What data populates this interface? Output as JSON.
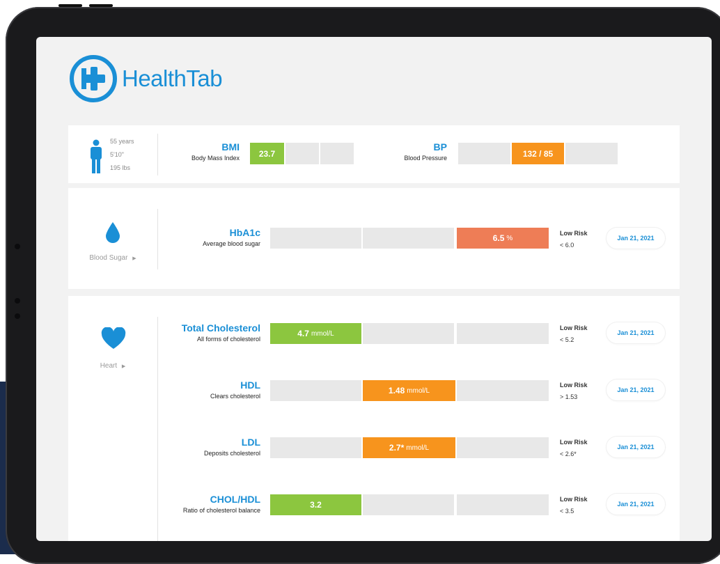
{
  "app": {
    "name": "HealthTab"
  },
  "profile": {
    "age": "55 years",
    "height": "5'10\"",
    "weight": "195 lbs"
  },
  "vitals": {
    "bmi": {
      "title": "BMI",
      "subtitle": "Body Mass Index",
      "value": "23.7",
      "level": 1
    },
    "bp": {
      "title": "BP",
      "subtitle": "Blood Pressure",
      "value": "132 / 85",
      "level": 2
    }
  },
  "sections": {
    "blood_sugar": {
      "label": "Blood Sugar",
      "metrics": {
        "hba1c": {
          "title": "HbA1c",
          "subtitle": "Average blood sugar",
          "value": "6.5",
          "unit": "%",
          "risk": "Low Risk",
          "threshold": "< 6.0",
          "date": "Jan 21, 2021",
          "level": 3
        }
      }
    },
    "heart": {
      "label": "Heart",
      "metrics": {
        "total": {
          "title": "Total Cholesterol",
          "subtitle": "All forms of cholesterol",
          "value": "4.7",
          "unit": "mmol/L",
          "risk": "Low Risk",
          "threshold": "< 5.2",
          "date": "Jan 21, 2021",
          "level": 1
        },
        "hdl": {
          "title": "HDL",
          "subtitle": "Clears cholesterol",
          "value": "1.48",
          "unit": "mmol/L",
          "risk": "Low Risk",
          "threshold": "> 1.53",
          "date": "Jan 21, 2021",
          "level": 2
        },
        "ldl": {
          "title": "LDL",
          "subtitle": "Deposits cholesterol",
          "value": "2.7*",
          "unit": "mmol/L",
          "risk": "Low Risk",
          "threshold": "< 2.6*",
          "date": "Jan 21, 2021",
          "level": 2
        },
        "chol_hdl": {
          "title": "CHOL/HDL",
          "subtitle": "Ratio of cholesterol balance",
          "value": "3.2",
          "unit": "",
          "risk": "Low Risk",
          "threshold": "< 3.5",
          "date": "Jan 21, 2021",
          "level": 1
        }
      }
    }
  },
  "colors": {
    "accent": "#1a8fd6",
    "green": "#8cc63f",
    "orange": "#f7941d",
    "salmon": "#ee7d56"
  },
  "icons": {
    "logo": "healthtab-cross-logo",
    "person": "person-icon",
    "drop": "blood-drop-icon",
    "heart": "heart-icon",
    "chevron": "chevron-right-icon"
  }
}
